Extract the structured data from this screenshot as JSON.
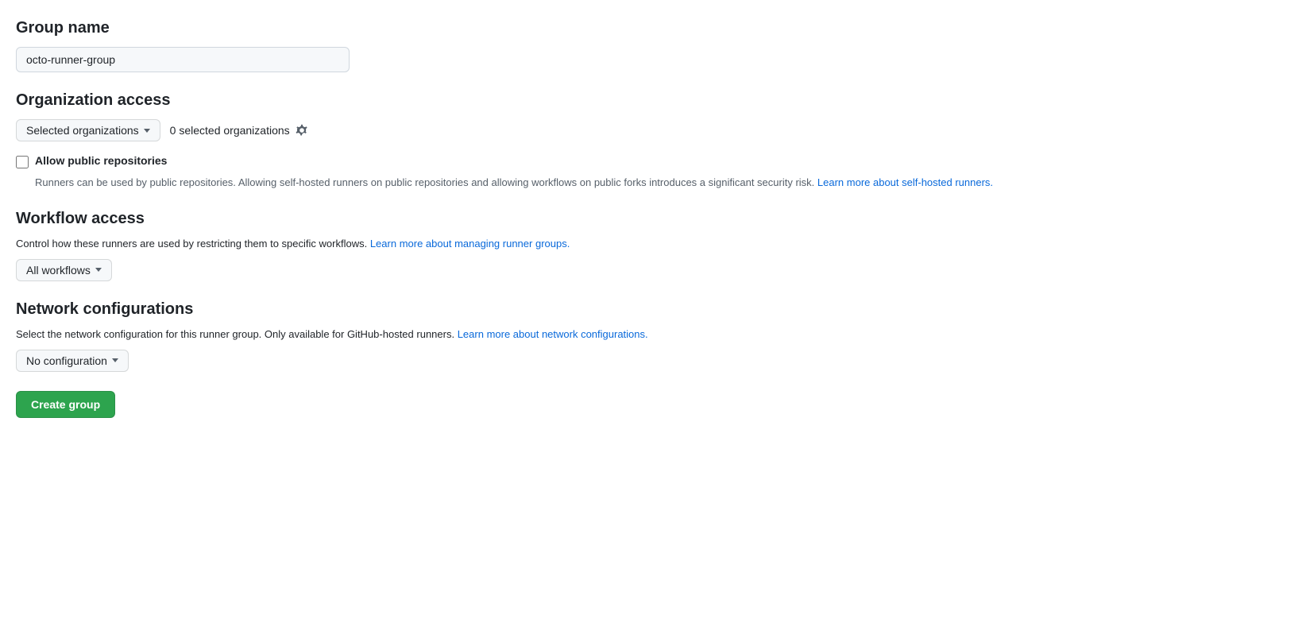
{
  "group_name": {
    "label": "Group name",
    "input_value": "octo-runner-group",
    "input_placeholder": "octo-runner-group"
  },
  "organization_access": {
    "label": "Organization access",
    "dropdown_label": "Selected organizations",
    "selected_count_text": "0 selected organizations",
    "gear_icon": "gear-icon",
    "chevron_icon": "chevron-down-icon",
    "allow_public": {
      "checkbox_label": "Allow public repositories",
      "description": "Runners can be used by public repositories. Allowing self-hosted runners on public repositories and allowing workflows on public forks introduces a significant security risk.",
      "link_text": "Learn more about self-hosted runners.",
      "link_href": "#"
    }
  },
  "workflow_access": {
    "label": "Workflow access",
    "description_text": "Control how these runners are used by restricting them to specific workflows.",
    "link_text": "Learn more about managing runner groups.",
    "link_href": "#",
    "dropdown_label": "All workflows",
    "chevron_icon": "chevron-down-icon"
  },
  "network_configurations": {
    "label": "Network configurations",
    "description_text": "Select the network configuration for this runner group. Only available for GitHub-hosted runners.",
    "link_text": "Learn more about network configurations.",
    "link_href": "#",
    "dropdown_label": "No configuration",
    "chevron_icon": "chevron-down-icon"
  },
  "create_group_button": {
    "label": "Create group"
  }
}
